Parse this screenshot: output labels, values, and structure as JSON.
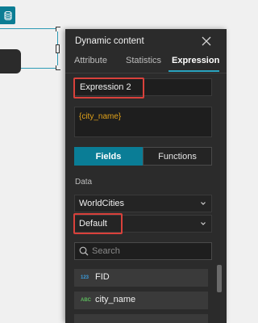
{
  "canvas": {
    "data_button_icon": "database-icon"
  },
  "panel": {
    "title": "Dynamic content",
    "close_icon": "close-icon",
    "tabs": [
      {
        "label": "Attribute",
        "active": false
      },
      {
        "label": "Statistics",
        "active": false
      },
      {
        "label": "Expression",
        "active": true
      }
    ],
    "expression_name": "Expression 2",
    "expression_text": "{city_name}",
    "segments": {
      "fields": "Fields",
      "functions": "Functions",
      "active": "Fields"
    },
    "data_label": "Data",
    "data_source": "WorldCities",
    "view": "Default",
    "search_placeholder": "Search",
    "fields": [
      {
        "type": "123",
        "name": "FID",
        "type_color": "#3b9ee0"
      },
      {
        "type": "ABC",
        "name": "city_name",
        "type_color": "#5cb85c"
      }
    ],
    "highlight_color": "#d9413b",
    "accent_color": "#0a7d96"
  }
}
